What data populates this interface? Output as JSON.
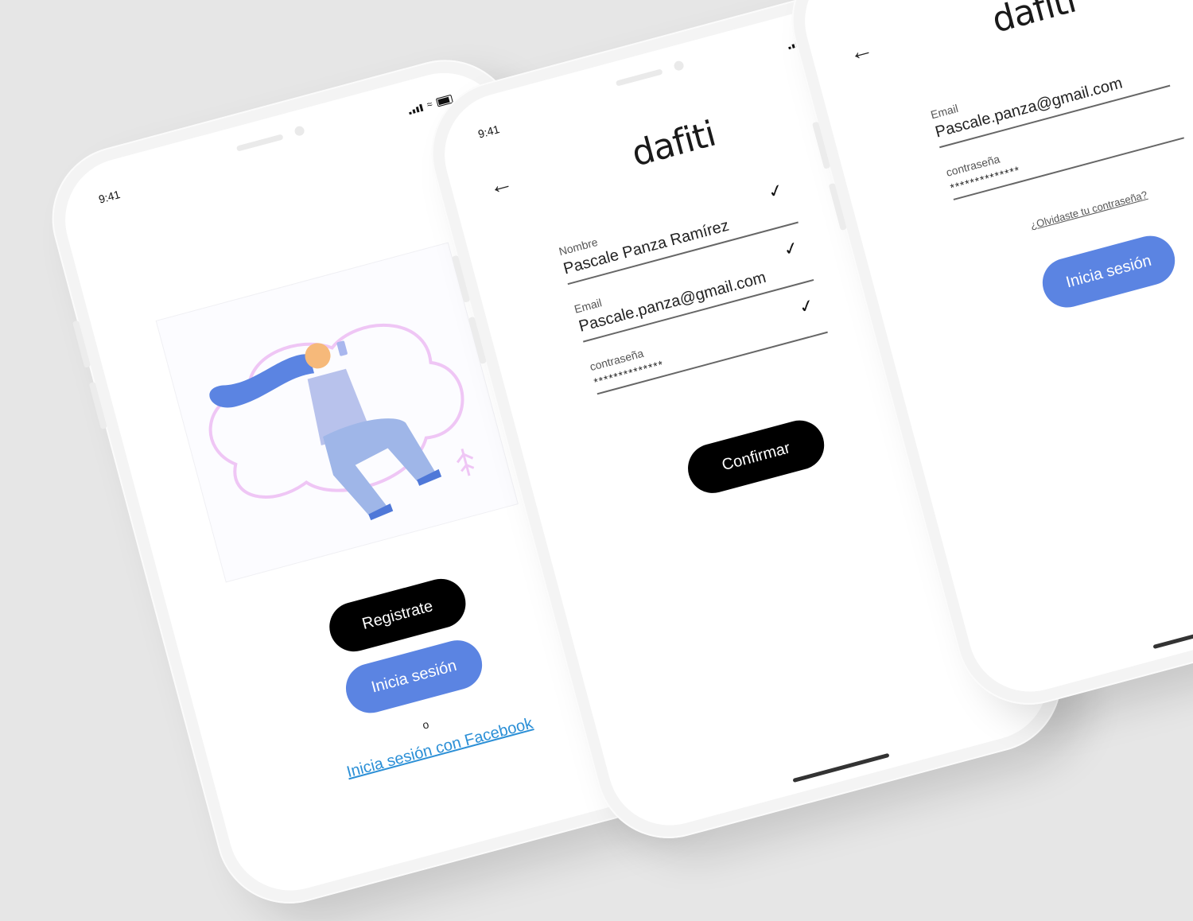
{
  "status_bar": {
    "time": "9:41"
  },
  "onboarding": {
    "register_label": "Registrate",
    "login_label": "Inicia sesión",
    "or_label": "o",
    "facebook_label": "Inicia sesión con Facebook"
  },
  "signup": {
    "logo": "dafiti",
    "name_label": "Nombre",
    "name_value": "Pascale Panza Ramírez",
    "email_label": "Email",
    "email_value": "Pascale.panza@gmail.com",
    "password_label": "contraseña",
    "password_value": "**************",
    "confirm_label": "Confirmar"
  },
  "login": {
    "logo": "dafiti",
    "email_label": "Email",
    "email_value": "Pascale.panza@gmail.com",
    "password_label": "contraseña",
    "password_value": "**************",
    "forgot_label": "¿Olvidaste tu contraseña?",
    "login_label": "Inicia sesión"
  },
  "colors": {
    "accent_blue": "#5b84e2",
    "link_blue": "#2b8fd6",
    "primary_black": "#000000"
  }
}
